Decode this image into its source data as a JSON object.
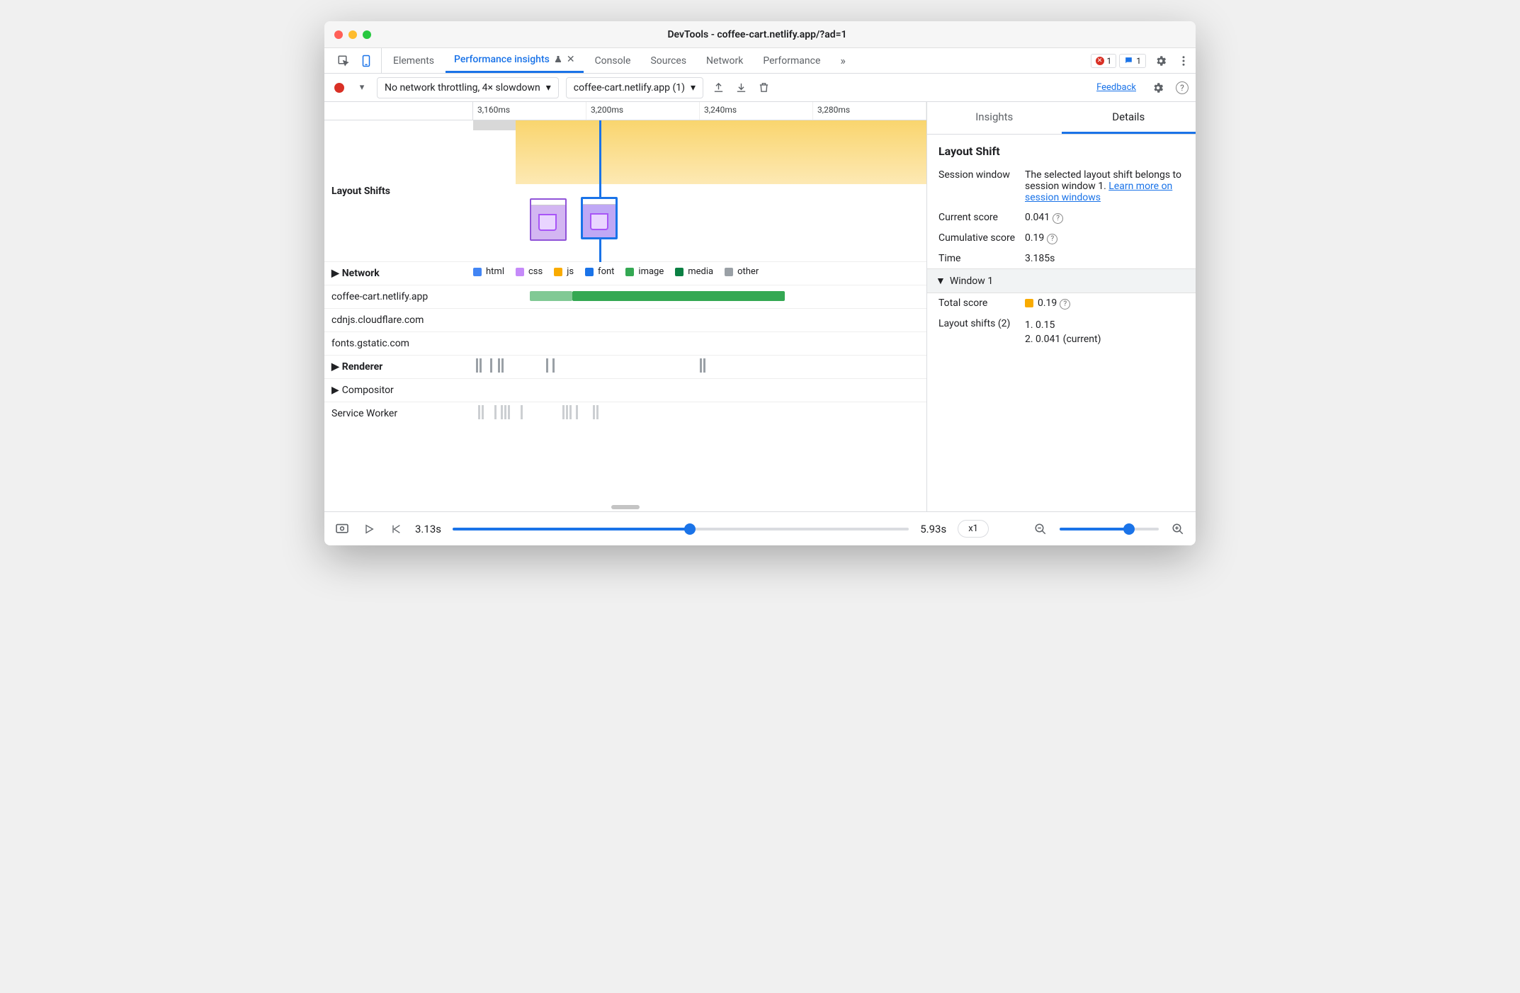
{
  "window": {
    "title": "DevTools - coffee-cart.netlify.app/?ad=1"
  },
  "tabs": {
    "items": [
      "Elements",
      "Performance insights",
      "Console",
      "Sources",
      "Network",
      "Performance"
    ],
    "active_index": 1,
    "errors_badge": "1",
    "info_badge": "1",
    "overflow_glyph": "»"
  },
  "toolbar": {
    "throttling_label": "No network throttling, 4× slowdown",
    "recording_select": "coffee-cart.netlify.app (1)",
    "feedback": "Feedback"
  },
  "timeline": {
    "ticks": [
      "3,160ms",
      "3,200ms",
      "3,240ms",
      "3,280ms"
    ],
    "layout_shifts_label": "Layout Shifts",
    "network_label": "Network",
    "renderer_label": "Renderer",
    "compositor_label": "Compositor",
    "service_worker_label": "Service Worker",
    "net_rows": [
      "coffee-cart.netlify.app",
      "cdnjs.cloudflare.com",
      "fonts.gstatic.com"
    ],
    "legend": [
      {
        "label": "html",
        "color": "#4285f4"
      },
      {
        "label": "css",
        "color": "#c58af9"
      },
      {
        "label": "js",
        "color": "#f9ab00"
      },
      {
        "label": "font",
        "color": "#1a73e8"
      },
      {
        "label": "image",
        "color": "#34a853"
      },
      {
        "label": "media",
        "color": "#0b8043"
      },
      {
        "label": "other",
        "color": "#9aa0a6"
      }
    ]
  },
  "right": {
    "tabs": {
      "insights": "Insights",
      "details": "Details",
      "active": "details"
    },
    "title": "Layout Shift",
    "session_window_label": "Session window",
    "session_window_text": "The selected layout shift belongs to session window 1. ",
    "session_window_link": "Learn more on session windows",
    "current_score_label": "Current score",
    "current_score_value": "0.041",
    "cumulative_score_label": "Cumulative score",
    "cumulative_score_value": "0.19",
    "time_label": "Time",
    "time_value": "3.185s",
    "window_header": "Window 1",
    "total_score_label": "Total score",
    "total_score_value": "0.19",
    "total_score_color": "#f9ab00",
    "layout_shifts_label": "Layout shifts (2)",
    "layout_shifts_items": [
      "1. 0.15",
      "2. 0.041 (current)"
    ]
  },
  "footer": {
    "start_time": "3.13s",
    "end_time": "5.93s",
    "speed": "x1",
    "playhead_pct": 52,
    "zoom_pct": 70
  }
}
